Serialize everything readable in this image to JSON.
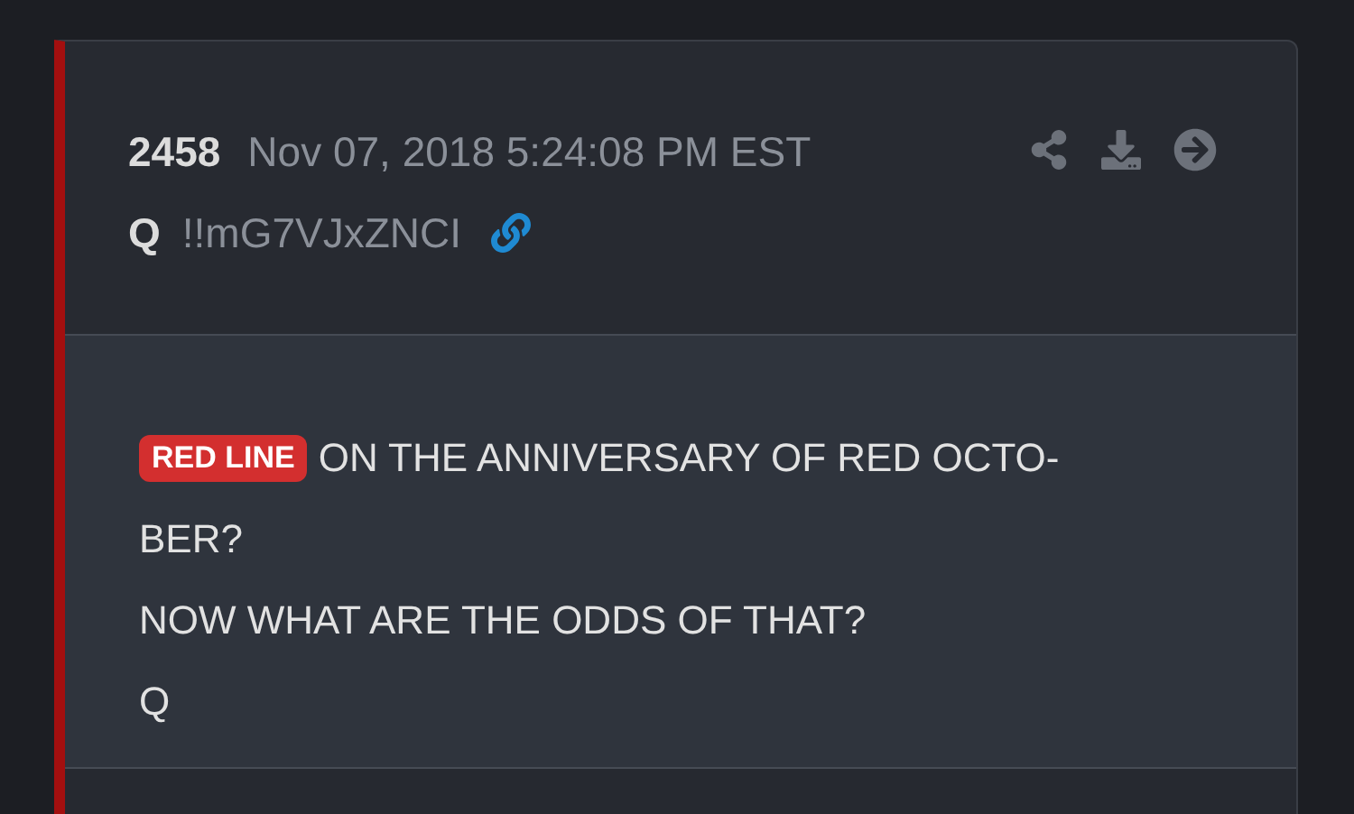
{
  "post": {
    "number": "2458",
    "date": "Nov 07, 2018 5:24:08 PM EST",
    "author": "Q",
    "tripcode": "!!mG7VJxZNCI",
    "tag": {
      "label": "RED LINE",
      "color": "#d32f2f"
    },
    "lines": [
      "ON THE ANNIVERSARY OF RED OCTO-",
      "BER?",
      "NOW WHAT ARE THE ODDS OF THAT?",
      "Q"
    ]
  }
}
